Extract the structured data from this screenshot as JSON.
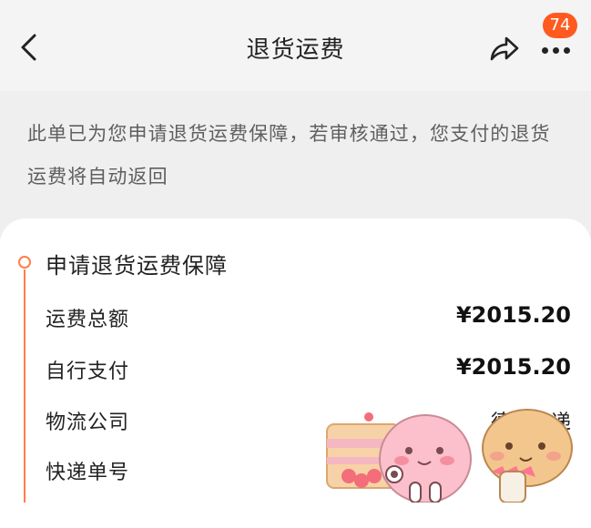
{
  "nav": {
    "title": "退货运费",
    "badge_count": "74",
    "icons": {
      "back": "chevron-left-icon",
      "share": "share-icon",
      "more": "more-icon"
    }
  },
  "notice": {
    "text": "此单已为您申请退货运费保障，若审核通过，您支付的退货运费将自动返回"
  },
  "section": {
    "title": "申请退货运费保障",
    "rows": [
      {
        "label": "运费总额",
        "value": "¥2015.20"
      },
      {
        "label": "自行支付",
        "value": "¥2015.20"
      },
      {
        "label": "物流公司",
        "value": "德邦快递"
      },
      {
        "label": "快递单号",
        "value": ""
      }
    ]
  },
  "colors": {
    "accent": "#ff7f4a",
    "badge": "#ff5a1f"
  }
}
